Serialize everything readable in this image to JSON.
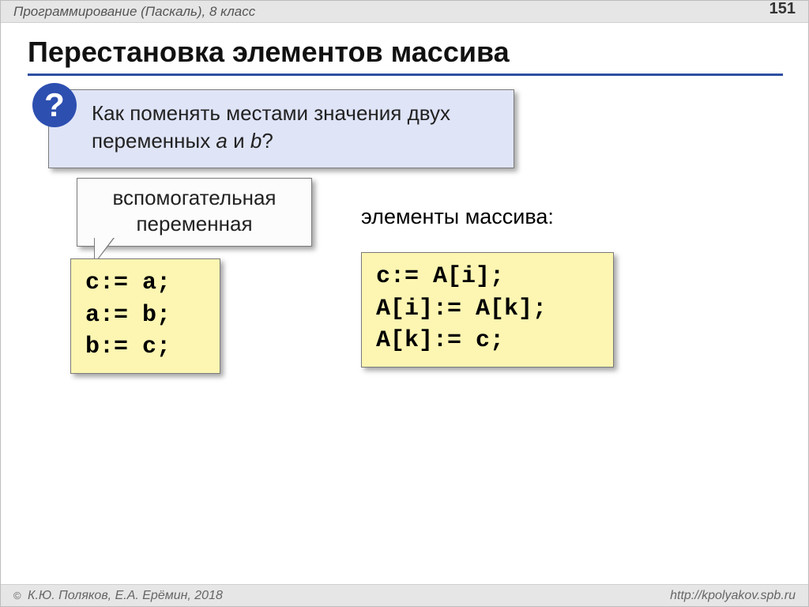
{
  "header": {
    "course": "Программирование (Паскаль), 8 класс",
    "page": "151"
  },
  "title": "Перестановка элементов массива",
  "question": {
    "mark": "?",
    "line1": "Как поменять местами значения двух",
    "line2_prefix": "переменных ",
    "var_a": "a",
    "and": " и ",
    "var_b": "b",
    "line2_suffix": "?"
  },
  "callout": {
    "line1": "вспомогательная",
    "line2": "переменная"
  },
  "label_array": "элементы массива:",
  "code_left": "c:= a;\na:= b;\nb:= c;",
  "code_right": "c:= A[i];\nA[i]:= A[k];\nA[k]:= c;",
  "footer": {
    "copyright_symbol": "©",
    "authors": " К.Ю. Поляков, Е.А. Ерёмин, 2018",
    "url": "http://kpolyakov.spb.ru"
  }
}
